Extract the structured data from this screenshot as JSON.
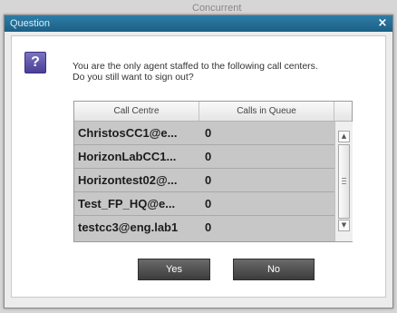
{
  "background": {
    "tab_text": "Concurrent"
  },
  "dialog": {
    "title": "Question",
    "close_glyph": "×",
    "icon": "question-icon",
    "message_line1": "You are the only agent staffed to the following call centers.",
    "message_line2": "Do you still want to sign out?",
    "table": {
      "columns": [
        "Call Centre",
        "Calls in Queue"
      ],
      "rows": [
        {
          "name": "ChristosCC1@e...",
          "calls": "0"
        },
        {
          "name": "HorizonLabCC1...",
          "calls": "0"
        },
        {
          "name": "Horizontest02@...",
          "calls": "0"
        },
        {
          "name": "Test_FP_HQ@e...",
          "calls": "0"
        },
        {
          "name": "testcc3@eng.lab1",
          "calls": "0"
        }
      ]
    },
    "buttons": {
      "yes_label": "Yes",
      "no_label": "No"
    }
  },
  "colors": {
    "titlebar": "#1c5f86",
    "row_background": "#c7c7c7",
    "button": "#4a4a4a",
    "icon": "#5a50a8"
  }
}
